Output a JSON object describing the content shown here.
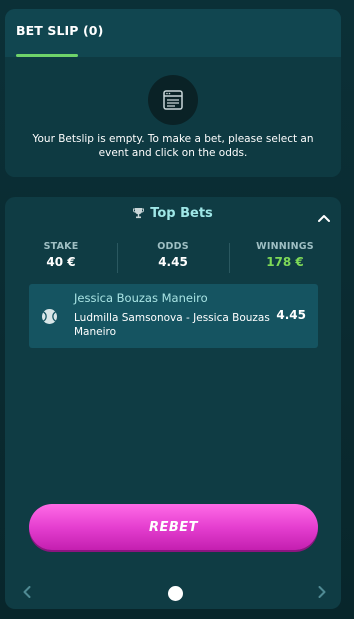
{
  "betslip": {
    "title": "BET SLIP (0)",
    "empty_icon": "browser-window-icon",
    "empty_message": "Your Betslip is empty. To make a bet, please select an event and click on the odds."
  },
  "top_bets": {
    "title": "Top Bets",
    "title_icon": "trophy-icon",
    "collapse_icon": "chevron-up-icon",
    "stats": {
      "stake_label": "STAKE",
      "stake_value": "40 €",
      "odds_label": "ODDS",
      "odds_value": "4.45",
      "winnings_label": "WINNINGS",
      "winnings_value": "178 €"
    },
    "selection": {
      "sport_icon": "tennis-ball-icon",
      "name": "Jessica Bouzas Maneiro",
      "event": "Ludmilla Samsonova - Jessica Bouzas Maneiro",
      "odds": "4.45"
    },
    "rebet_label": "REBET",
    "pager": {
      "page_count": 1,
      "current_page": 1
    }
  },
  "colors": {
    "background": "#0a2a30",
    "card": "#0f3c44",
    "accent_green": "#7ed957",
    "title_cyan": "#9fe7e7",
    "rebet_pink": "#e53fd0"
  }
}
